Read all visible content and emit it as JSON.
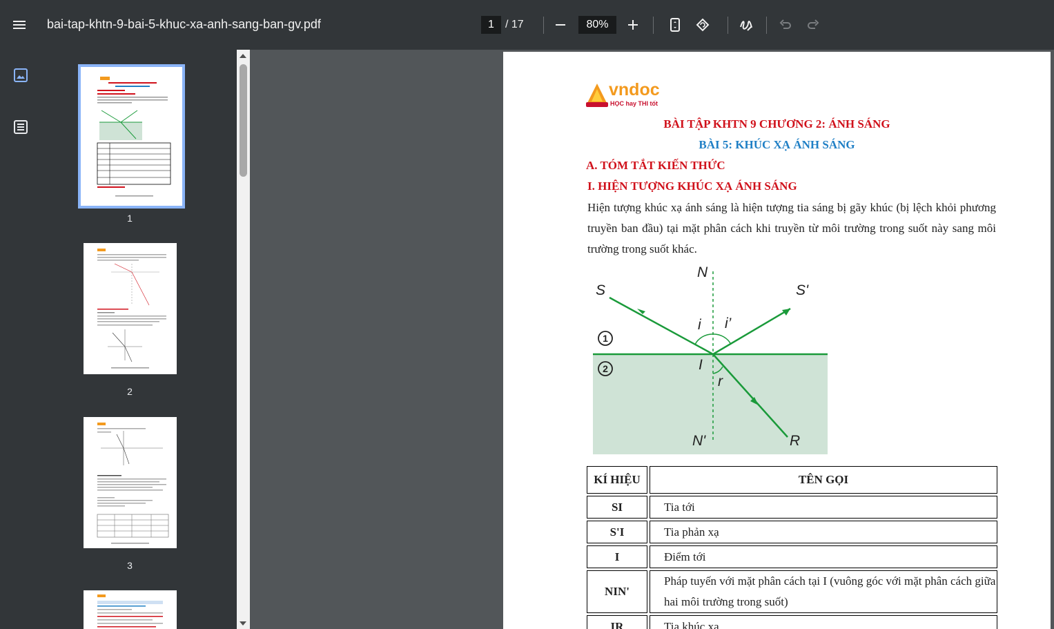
{
  "toolbar": {
    "file_name": "bai-tap-khtn-9-bai-5-khuc-xa-anh-sang-ban-gv.pdf",
    "current_page": "1",
    "page_separator": "/",
    "total_pages": "17",
    "zoom": "80%",
    "icons": [
      "menu-icon",
      "zoom-out-icon",
      "zoom-in-icon",
      "fit-page-icon",
      "rotate-icon",
      "annotate-icon",
      "undo-icon",
      "redo-icon"
    ]
  },
  "sidebar": {
    "icons": [
      "thumbnails-icon",
      "outline-icon"
    ],
    "thumbnails": [
      {
        "label": "1",
        "active": true
      },
      {
        "label": "2",
        "active": false
      },
      {
        "label": "3",
        "active": false
      }
    ]
  },
  "page": {
    "logo_text": "vndoc",
    "logo_tagline": "HỌC hay THI tốt",
    "title": "BÀI TẬP KHTN 9 CHƯƠNG 2: ÁNH SÁNG",
    "subtitle": "BÀI 5: KHÚC XẠ ÁNH SÁNG",
    "section_a": "A. TÓM TẮT KIẾN THỨC",
    "section_i": "I. HIỆN TƯỢNG KHÚC XẠ ÁNH  SÁNG",
    "paragraph": "Hiện tượng khúc xạ ánh sáng là hiện tượng tia sáng bị gãy khúc (bị lệch khỏi phương truyền ban đầu) tại mặt phân cách khi truyền từ môi trường trong suốt này sang môi trường trong suốt khác.",
    "figure_labels": {
      "N": "N",
      "S": "S",
      "S_prime": "S'",
      "i": "i",
      "i_prime": "i’",
      "medium1": "1",
      "medium2": "2",
      "I": "I",
      "r": "r",
      "N_prime": "N'",
      "R": "R"
    },
    "table": {
      "headers": [
        "KÍ HIỆU",
        "TÊN GỌI"
      ],
      "rows": [
        [
          "SI",
          "Tia tới"
        ],
        [
          "S'I",
          "Tia phản xạ"
        ],
        [
          "I",
          "Điểm tới"
        ],
        [
          "NIN'",
          "Pháp tuyến với mặt phân cách tại I (vuông góc với mặt phân cách giữa hai môi trường trong suốt)"
        ],
        [
          "IR",
          "Tia khúc xạ"
        ]
      ]
    },
    "colors": {
      "title": "#d0111b",
      "subtitle": "#1f7fc5",
      "medium2": "#cfe3d6",
      "ray": "#1a9a3a"
    }
  }
}
